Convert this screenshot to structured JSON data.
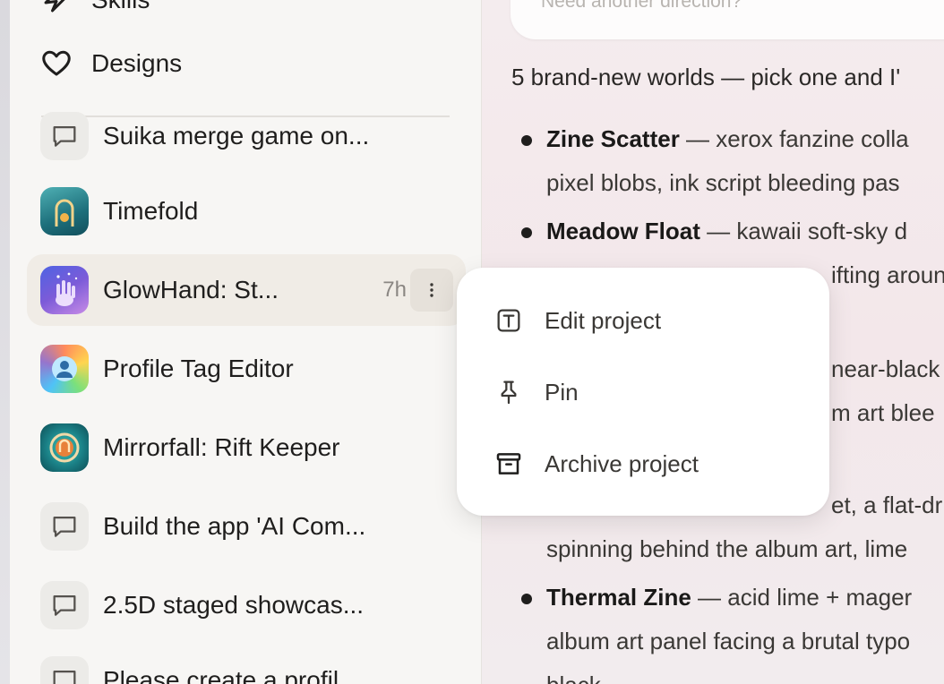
{
  "sidebar": {
    "nav": [
      {
        "label": "Skills",
        "icon": "sparkle-icon"
      },
      {
        "label": "Designs",
        "icon": "heart-icon"
      }
    ],
    "projects": [
      {
        "label": "Suika merge game on...",
        "thumb": "chat-icon"
      },
      {
        "label": "Timefold",
        "thumb": "timefold-app-icon"
      },
      {
        "label": "GlowHand: St...",
        "time": "7h",
        "thumb": "glowhand-app-icon",
        "active": true
      },
      {
        "label": "Profile Tag Editor",
        "thumb": "profile-tag-app-icon"
      },
      {
        "label": "Mirrorfall: Rift Keeper",
        "thumb": "mirrorfall-app-icon"
      },
      {
        "label": "Build the app 'AI Com...",
        "thumb": "chat-icon"
      },
      {
        "label": "2.5D staged showcas...",
        "thumb": "chat-icon"
      },
      {
        "label": "Please create a profil...",
        "thumb": "chat-icon"
      }
    ]
  },
  "main": {
    "input_placeholder": "Need another direction?",
    "intro": "5 brand-new worlds — pick one and I'",
    "lines": [
      {
        "bold": "Zine Scatter",
        "text": " — xerox fanzine colla"
      },
      {
        "bold": "",
        "text": "pixel blobs, ink script bleeding pas"
      },
      {
        "bold": "Meadow Float",
        "text": " — kawaii soft-sky d"
      },
      {
        "bold": "",
        "text": "ifting aroun"
      },
      {
        "bold": "",
        "text": "near-black"
      },
      {
        "bold": "",
        "text": "m art blee"
      },
      {
        "bold": "",
        "text": "et, a flat-dr"
      },
      {
        "bold": "",
        "text": "spinning behind the album art, lime"
      },
      {
        "bold": "Thermal Zine",
        "text": " — acid lime + mager"
      },
      {
        "bold": "",
        "text": "album art panel facing a brutal typo"
      },
      {
        "bold": "",
        "text": "black"
      }
    ]
  },
  "context_menu": {
    "items": [
      {
        "label": "Edit project",
        "icon": "text-edit-icon"
      },
      {
        "label": "Pin",
        "icon": "pin-icon"
      },
      {
        "label": "Archive project",
        "icon": "archive-icon"
      }
    ]
  }
}
